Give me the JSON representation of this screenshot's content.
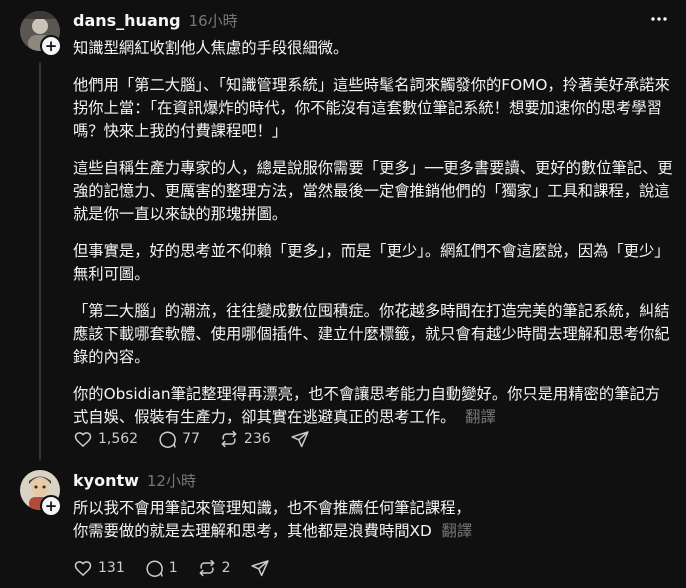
{
  "posts": [
    {
      "username": "dans_huang",
      "time": "16小時",
      "more_label": "···",
      "paragraphs": [
        "知識型網紅收割他人焦慮的手段很細微。",
        "他們用「第二大腦」、「知識管理系統」這些時髦名詞來觸發你的FOMO，拎著美好承諾來拐你上當：「在資訊爆炸的時代，你不能沒有這套數位筆記系統！想要加速你的思考學習嗎？快來上我的付費課程吧！」",
        "這些自稱生產力專家的人，總是說服你需要「更多」──更多書要讀、更好的數位筆記、更強的記憶力、更厲害的整理方法，當然最後一定會推銷他們的「獨家」工具和課程，說這就是你一直以來缺的那塊拼圖。",
        "但事實是，好的思考並不仰賴「更多」，而是「更少」。網紅們不會這麼說，因為「更少」無利可圖。",
        "「第二大腦」的潮流，往往變成數位囤積症。你花越多時間在打造完美的筆記系統，糾結應該下載哪套軟體、使用哪個插件、建立什麼標籤，就只會有越少時間去理解和思考你紀錄的內容。",
        "你的Obsidian筆記整理得再漂亮，也不會讓思考能力自動變好。你只是用精密的筆記方式自娛、假裝有生產力，卻其實在逃避真正的思考工作。"
      ],
      "translate_label": "翻譯",
      "likes": "1,562",
      "comments": "77",
      "reposts": "236"
    },
    {
      "username": "kyontw",
      "time": "12小時",
      "paragraphs": [
        "所以我不會用筆記來管理知識，也不會推薦任何筆記課程，",
        "你需要做的就是去理解和思考，其他都是浪費時間XD"
      ],
      "translate_label": "翻譯",
      "likes": "131",
      "comments": "1",
      "reposts": "2"
    }
  ],
  "icons": [
    "heart-icon",
    "comment-icon",
    "repost-icon",
    "share-icon",
    "more-icon",
    "follow-plus-icon"
  ],
  "colors": {
    "background": "#101010",
    "text": "#f3f5f7",
    "muted": "#777777",
    "thread_line": "#333638"
  }
}
